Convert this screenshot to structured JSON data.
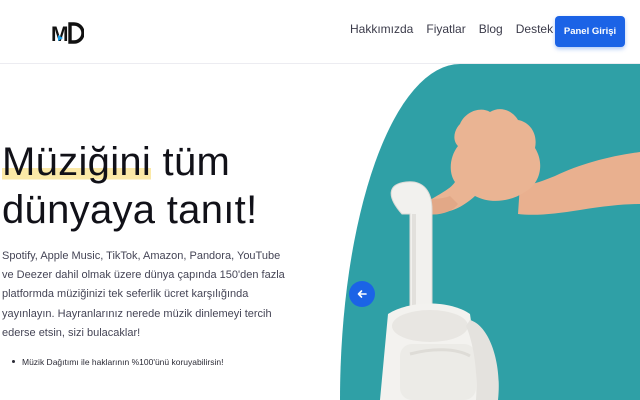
{
  "header": {
    "logo": {
      "text": "MD",
      "icon": "md-logo"
    },
    "nav": [
      "Hakkımızda",
      "Fiyatlar",
      "Blog",
      "Destek"
    ],
    "panel_button": "Panel Girişi"
  },
  "hero": {
    "title_highlight": "Müziğini",
    "title_rest_line1": " tüm",
    "title_line2": "dünyaya tanıt!",
    "description": "Spotify, Apple Music, TikTok, Amazon, Pandora, YouTube ve Deezer dahil olmak üzere dünya çapında 150'den fazla platformda müziğinizi tek seferlik ücret karşılığında yayınlayın. Hayranlarınız nerede müzik dinlemeyi tercih ederse etsin, sizi bulacaklar!",
    "bullets": [
      "Müzik Dağıtımı ile haklarının %100'ünü koruyabilirsin!"
    ]
  },
  "slider": {
    "image": "headphones-hand-photo",
    "prev_icon": "arrow-left-icon"
  },
  "colors": {
    "accent": "#1b63e6",
    "photo_bg": "#2fa0a6",
    "highlight": "#fbe9a7"
  }
}
